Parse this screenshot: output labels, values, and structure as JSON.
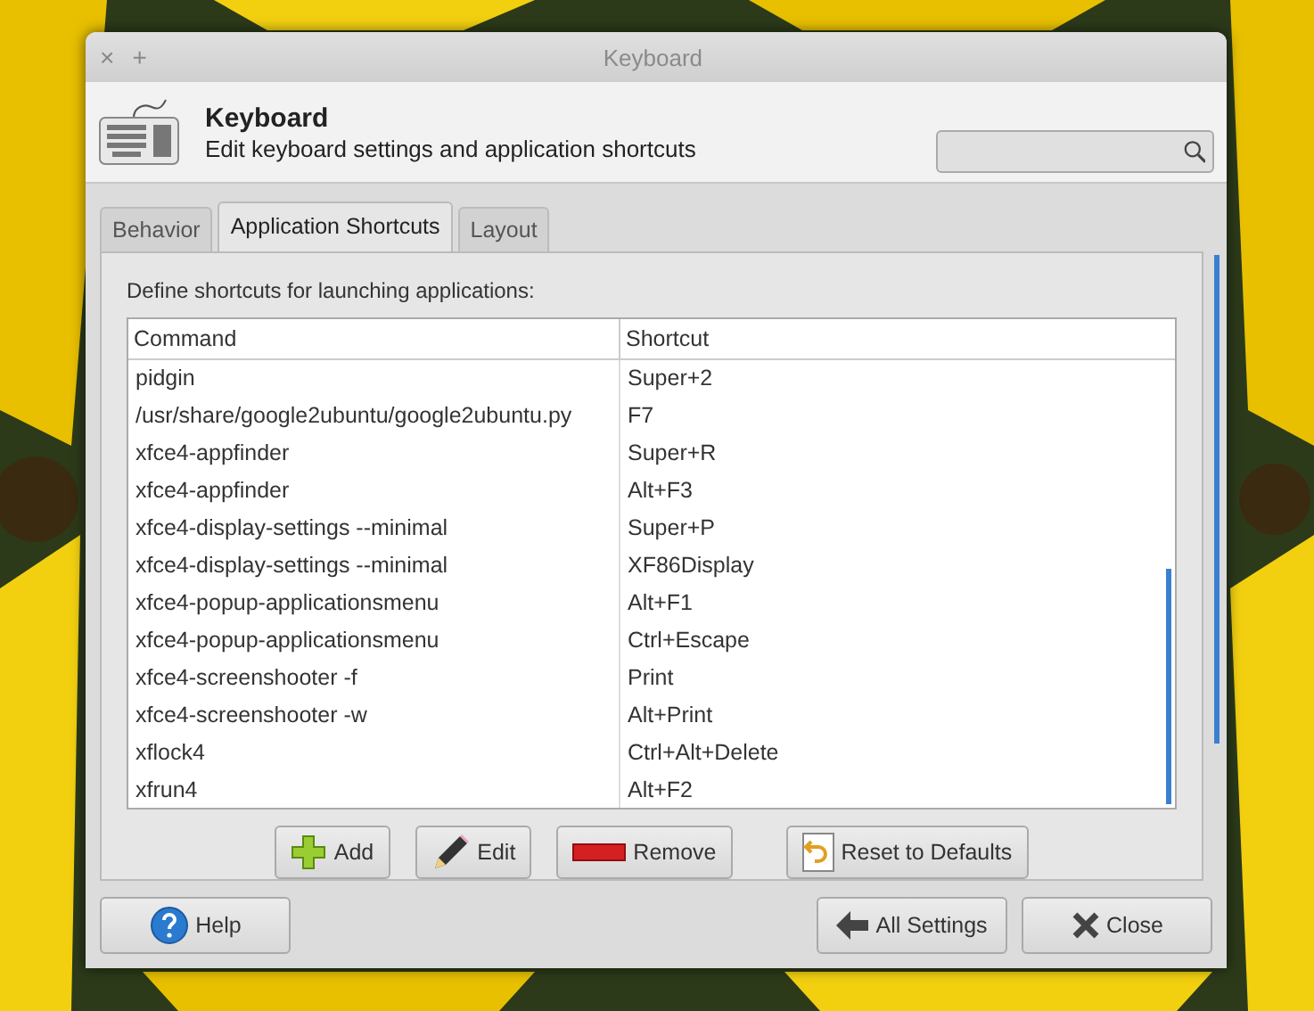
{
  "window": {
    "title": "Keyboard",
    "close_glyph": "×",
    "stick_glyph": "+"
  },
  "header": {
    "title": "Keyboard",
    "subtitle": "Edit keyboard settings and application shortcuts"
  },
  "tabs": [
    {
      "label": "Behavior",
      "selected": false
    },
    {
      "label": "Application Shortcuts",
      "selected": true
    },
    {
      "label": "Layout",
      "selected": false
    }
  ],
  "description": "Define shortcuts for launching applications:",
  "table": {
    "columns": [
      "Command",
      "Shortcut"
    ],
    "rows": [
      {
        "command": "pidgin",
        "shortcut": "Super+2"
      },
      {
        "command": "/usr/share/google2ubuntu/google2ubuntu.py",
        "shortcut": "F7"
      },
      {
        "command": "xfce4-appfinder",
        "shortcut": "Super+R"
      },
      {
        "command": "xfce4-appfinder",
        "shortcut": "Alt+F3"
      },
      {
        "command": "xfce4-display-settings --minimal",
        "shortcut": "Super+P"
      },
      {
        "command": "xfce4-display-settings --minimal",
        "shortcut": "XF86Display"
      },
      {
        "command": "xfce4-popup-applicationsmenu",
        "shortcut": "Alt+F1"
      },
      {
        "command": "xfce4-popup-applicationsmenu",
        "shortcut": "Ctrl+Escape"
      },
      {
        "command": "xfce4-screenshooter -f",
        "shortcut": "Print"
      },
      {
        "command": "xfce4-screenshooter -w",
        "shortcut": "Alt+Print"
      },
      {
        "command": "xflock4",
        "shortcut": "Ctrl+Alt+Delete"
      },
      {
        "command": "xfrun4",
        "shortcut": "Alt+F2"
      }
    ]
  },
  "actions": [
    {
      "kind": "add",
      "label": "Add"
    },
    {
      "kind": "edit",
      "label": "Edit"
    },
    {
      "kind": "remove",
      "label": "Remove"
    },
    {
      "kind": "reset",
      "label": "Reset to Defaults"
    }
  ],
  "footer": [
    {
      "kind": "help",
      "label": "Help"
    },
    {
      "kind": "back",
      "label": "All Settings"
    },
    {
      "kind": "close",
      "label": "Close"
    }
  ]
}
